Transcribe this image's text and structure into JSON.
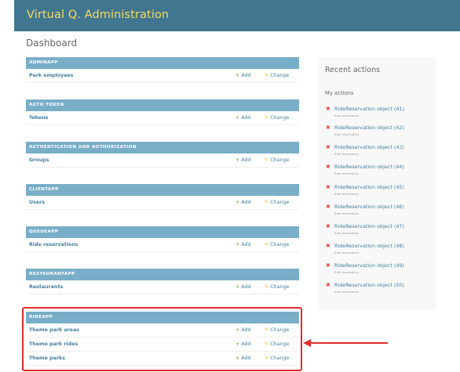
{
  "header": {
    "title": "Virtual Q. Administration"
  },
  "breadcrumb": "Dashboard",
  "modules": [
    {
      "caption": "ADMINAPP",
      "rows": [
        {
          "name": "Park employees",
          "add": "Add",
          "change": "Change"
        }
      ]
    },
    {
      "caption": "AUTH TOKEN",
      "rows": [
        {
          "name": "Tokens",
          "add": "Add",
          "change": "Change"
        }
      ]
    },
    {
      "caption": "AUTHENTICATION AND AUTHORIZATION",
      "rows": [
        {
          "name": "Groups",
          "add": "Add",
          "change": "Change"
        }
      ]
    },
    {
      "caption": "CLIENTAPP",
      "rows": [
        {
          "name": "Users",
          "add": "Add",
          "change": "Change"
        }
      ]
    },
    {
      "caption": "QUEUEAPP",
      "rows": [
        {
          "name": "Ride reservations",
          "add": "Add",
          "change": "Change"
        }
      ]
    },
    {
      "caption": "RESTAURANTAPP",
      "rows": [
        {
          "name": "Restaurants",
          "add": "Add",
          "change": "Change"
        }
      ]
    },
    {
      "caption": "RIDEAPP",
      "rows": [
        {
          "name": "Theme park areas",
          "add": "Add",
          "change": "Change"
        },
        {
          "name": "Theme park rides",
          "add": "Add",
          "change": "Change"
        },
        {
          "name": "Theme parks",
          "add": "Add",
          "change": "Change"
        }
      ]
    }
  ],
  "recent": {
    "title": "Recent actions",
    "subtitle": "My actions",
    "items": [
      {
        "object": "RideReservation object (41)",
        "type": "Ride reservation"
      },
      {
        "object": "RideReservation object (42)",
        "type": "Ride reservation"
      },
      {
        "object": "RideReservation object (43)",
        "type": "Ride reservation"
      },
      {
        "object": "RideReservation object (44)",
        "type": "Ride reservation"
      },
      {
        "object": "RideReservation object (45)",
        "type": "Ride reservation"
      },
      {
        "object": "RideReservation object (46)",
        "type": "Ride reservation"
      },
      {
        "object": "RideReservation object (47)",
        "type": "Ride reservation"
      },
      {
        "object": "RideReservation object (48)",
        "type": "Ride reservation"
      },
      {
        "object": "RideReservation object (49)",
        "type": "Ride reservation"
      },
      {
        "object": "RideReservation object (50)",
        "type": "Ride reservation"
      }
    ]
  },
  "icons": {
    "add": "plus-icon",
    "change": "pencil-icon",
    "delete": "delete-x-icon",
    "annotation": "left-arrow-icon"
  },
  "colors": {
    "header": "#417690",
    "header_text": "#f5dd5d",
    "caption": "#79aec8",
    "link": "#447e9b",
    "add_icon": "#70bf2b",
    "change_icon": "#efb80b",
    "delete_icon": "#dd4646",
    "highlight": "#e52b2b"
  }
}
